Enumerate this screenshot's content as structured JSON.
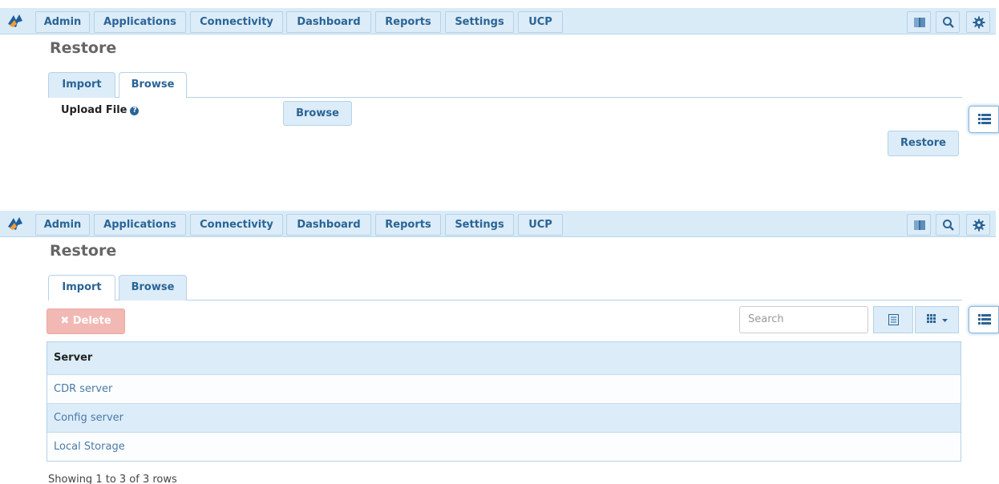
{
  "nav": {
    "items": [
      "Admin",
      "Applications",
      "Connectivity",
      "Dashboard",
      "Reports",
      "Settings",
      "UCP"
    ],
    "icons": [
      "book-icon",
      "search-icon",
      "gear-icon"
    ]
  },
  "page": {
    "title": "Restore"
  },
  "tabs": [
    "Import",
    "Browse"
  ],
  "import": {
    "upload_label": "Upload File",
    "help_glyph": "?",
    "browse_label": "Browse",
    "restore_label": "Restore"
  },
  "browse": {
    "delete_label": "✖ Delete",
    "search_placeholder": "Search",
    "table": {
      "header": "Server",
      "rows": [
        "CDR server",
        "Config server",
        "Local Storage"
      ]
    },
    "footer": "Showing 1 to 3 of 3 rows"
  },
  "colors": {
    "nav_bg": "#d9ebf7",
    "link": "#2a6496",
    "delete": "#f2b8b3",
    "row_alt": "#dcecf8"
  }
}
